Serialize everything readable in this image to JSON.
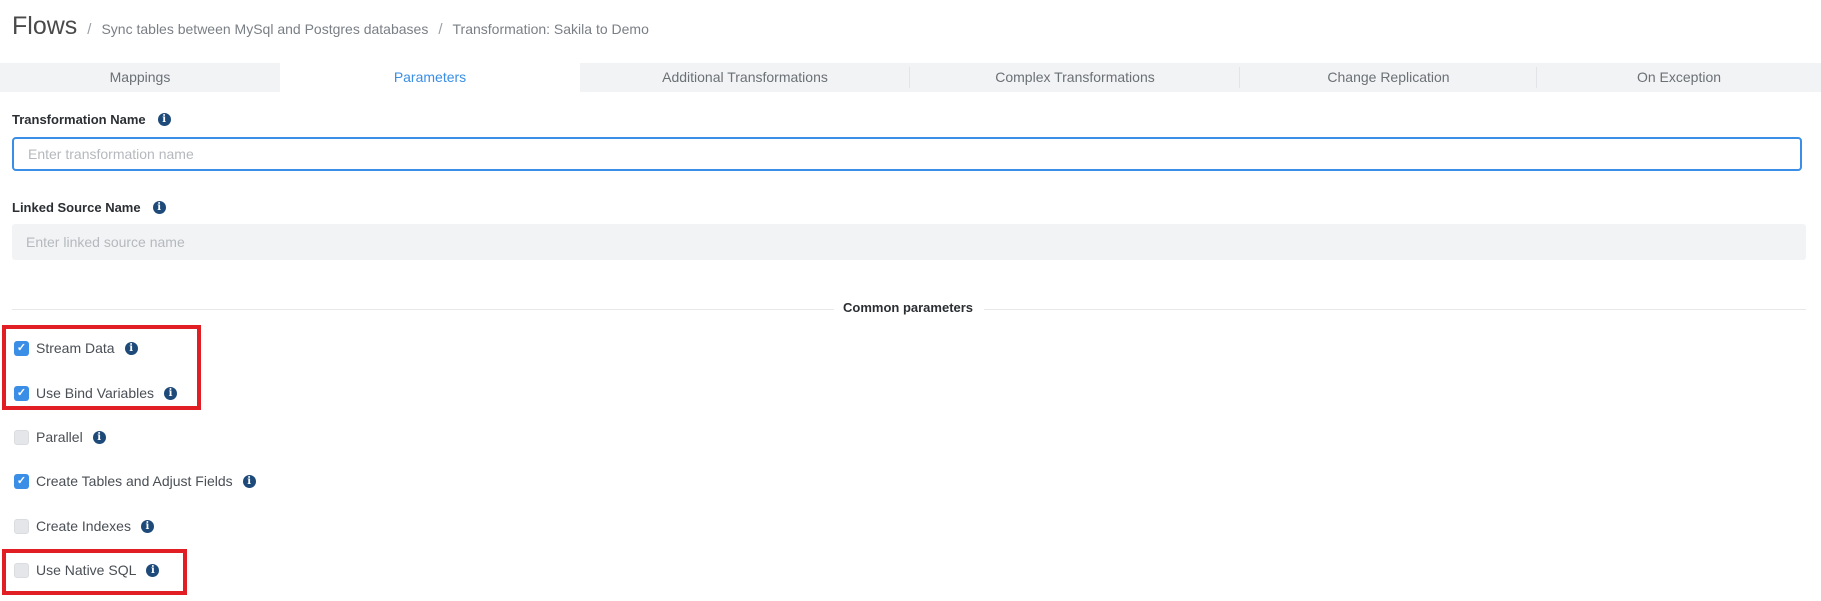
{
  "header": {
    "title": "Flows",
    "separator": "/",
    "breadcrumb_1": "Sync tables between MySql and Postgres databases",
    "breadcrumb_2": "Transformation: Sakila to Demo"
  },
  "tabs": [
    {
      "label": "Mappings",
      "active": false
    },
    {
      "label": "Parameters",
      "active": true
    },
    {
      "label": "Additional Transformations",
      "active": false
    },
    {
      "label": "Complex Transformations",
      "active": false
    },
    {
      "label": "Change Replication",
      "active": false
    },
    {
      "label": "On Exception",
      "active": false
    }
  ],
  "form": {
    "transformation_name_label": "Transformation Name",
    "transformation_name_value": "",
    "transformation_name_placeholder": "Enter transformation name",
    "linked_source_label": "Linked Source Name",
    "linked_source_value": "",
    "linked_source_placeholder": "Enter linked source name"
  },
  "common": {
    "title": "Common parameters",
    "options": [
      {
        "label": "Stream Data",
        "checked": true
      },
      {
        "label": "Use Bind Variables",
        "checked": true
      },
      {
        "label": "Parallel",
        "checked": false
      },
      {
        "label": "Create Tables and Adjust Fields",
        "checked": true
      },
      {
        "label": "Create Indexes",
        "checked": false
      },
      {
        "label": "Use Native SQL",
        "checked": false
      }
    ]
  },
  "icons": {
    "info": "info-icon",
    "check": "checkmark-icon"
  },
  "colors": {
    "accent": "#3a8ee6",
    "info_icon": "#1e4a7a",
    "highlight": "#e01e24"
  }
}
